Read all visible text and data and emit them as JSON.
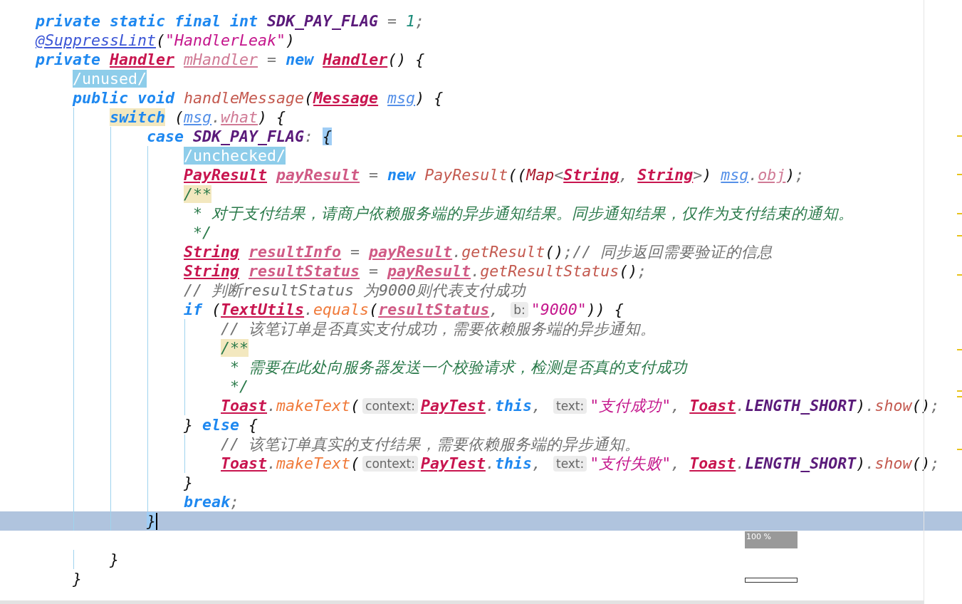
{
  "editor": {
    "zoom_label": "100 %",
    "lines": [
      {
        "current": false,
        "tokens": [
          {
            "kind": "keyword",
            "text": "private static final int"
          },
          {
            "kind": "constant",
            "text": " SDK_PAY_FLAG"
          },
          {
            "kind": "operator",
            "text": " = "
          },
          {
            "kind": "number",
            "text": "1"
          },
          {
            "kind": "operator",
            "text": ";"
          }
        ]
      },
      {
        "current": false,
        "tokens": [
          {
            "kind": "annotation",
            "text": "@SuppressLint"
          },
          {
            "kind": "punct",
            "text": "("
          },
          {
            "kind": "string",
            "text": "\"HandlerLeak\""
          },
          {
            "kind": "punct",
            "text": ")"
          }
        ]
      },
      {
        "current": false,
        "tokens": [
          {
            "kind": "keyword",
            "text": "private"
          },
          {
            "kind": "type",
            "text": " Handler"
          },
          {
            "kind": "field",
            "text": " mHandler"
          },
          {
            "kind": "operator",
            "text": " = "
          },
          {
            "kind": "keyword",
            "text": "new"
          },
          {
            "kind": "type",
            "text": " Handler"
          },
          {
            "kind": "punct",
            "text": "() {"
          }
        ]
      },
      {
        "current": false,
        "tokens": [
          {
            "kind": "tag",
            "text": "    /unused/"
          }
        ]
      },
      {
        "current": false,
        "tokens": [
          {
            "kind": "keyword",
            "text": "    public void"
          },
          {
            "kind": "method",
            "text": " handleMessage"
          },
          {
            "kind": "punct",
            "text": "("
          },
          {
            "kind": "type",
            "text": "Message"
          },
          {
            "kind": "param",
            "text": " msg"
          },
          {
            "kind": "punct",
            "text": ") {"
          }
        ]
      },
      {
        "current": false,
        "tokens": [
          {
            "kind": "marked",
            "text": "        switch"
          },
          {
            "kind": "punct",
            "text": " ("
          },
          {
            "kind": "param",
            "text": "msg"
          },
          {
            "kind": "operator",
            "text": "."
          },
          {
            "kind": "field",
            "text": "what"
          },
          {
            "kind": "punct",
            "text": ") {"
          }
        ]
      },
      {
        "current": false,
        "tokens": [
          {
            "kind": "keyword",
            "text": "            case"
          },
          {
            "kind": "constant",
            "text": " SDK_PAY_FLAG"
          },
          {
            "kind": "operator",
            "text": ": "
          },
          {
            "kind": "brace",
            "text": "{"
          }
        ]
      },
      {
        "current": false,
        "tokens": [
          {
            "kind": "tag",
            "text": "                /unchecked/"
          }
        ]
      },
      {
        "current": false,
        "tokens": [
          {
            "kind": "type",
            "text": "                PayResult"
          },
          {
            "kind": "local",
            "text": " payResult"
          },
          {
            "kind": "operator",
            "text": " = "
          },
          {
            "kind": "keyword",
            "text": "new"
          },
          {
            "kind": "method",
            "text": " PayResult"
          },
          {
            "kind": "punct",
            "text": "(("
          },
          {
            "kind": "class",
            "text": "Map"
          },
          {
            "kind": "operator",
            "text": "<"
          },
          {
            "kind": "type",
            "text": "String"
          },
          {
            "kind": "operator",
            "text": ", "
          },
          {
            "kind": "type",
            "text": "String"
          },
          {
            "kind": "operator",
            "text": ">"
          },
          {
            "kind": "punct",
            "text": ") "
          },
          {
            "kind": "param",
            "text": "msg"
          },
          {
            "kind": "operator",
            "text": "."
          },
          {
            "kind": "field",
            "text": "obj"
          },
          {
            "kind": "punct",
            "text": ")"
          },
          {
            "kind": "operator",
            "text": ";"
          }
        ]
      },
      {
        "current": false,
        "tokens": [
          {
            "kind": "docmark",
            "text": "                /**"
          }
        ]
      },
      {
        "current": false,
        "tokens": [
          {
            "kind": "doc",
            "text": "                 * 对于支付结果，请商户依赖服务端的异步通知结果。同步通知结果，仅作为支付结束的通知。"
          }
        ]
      },
      {
        "current": false,
        "tokens": [
          {
            "kind": "doc",
            "text": "                 */"
          }
        ]
      },
      {
        "current": false,
        "tokens": [
          {
            "kind": "type",
            "text": "                String"
          },
          {
            "kind": "local",
            "text": " resultInfo"
          },
          {
            "kind": "operator",
            "text": " = "
          },
          {
            "kind": "local",
            "text": "payResult"
          },
          {
            "kind": "operator",
            "text": "."
          },
          {
            "kind": "method",
            "text": "getResult"
          },
          {
            "kind": "punct",
            "text": "()"
          },
          {
            "kind": "operator",
            "text": ";"
          },
          {
            "kind": "comment",
            "text": "// 同步返回需要验证的信息"
          }
        ]
      },
      {
        "current": false,
        "tokens": [
          {
            "kind": "type",
            "text": "                String"
          },
          {
            "kind": "local",
            "text": " resultStatus"
          },
          {
            "kind": "operator",
            "text": " = "
          },
          {
            "kind": "local",
            "text": "payResult"
          },
          {
            "kind": "operator",
            "text": "."
          },
          {
            "kind": "method",
            "text": "getResultStatus"
          },
          {
            "kind": "punct",
            "text": "()"
          },
          {
            "kind": "operator",
            "text": ";"
          }
        ]
      },
      {
        "current": false,
        "tokens": [
          {
            "kind": "comment",
            "text": "                // 判断resultStatus 为9000则代表支付成功"
          }
        ]
      },
      {
        "current": false,
        "tokens": [
          {
            "kind": "keyword",
            "text": "                if"
          },
          {
            "kind": "punct",
            "text": " ("
          },
          {
            "kind": "type",
            "text": "TextUtils"
          },
          {
            "kind": "operator",
            "text": "."
          },
          {
            "kind": "call",
            "text": "equals"
          },
          {
            "kind": "punct",
            "text": "("
          },
          {
            "kind": "local",
            "text": "resultStatus"
          },
          {
            "kind": "operator",
            "text": ", "
          },
          {
            "kind": "hint",
            "text": "b:"
          },
          {
            "kind": "string",
            "text": "\"9000\""
          },
          {
            "kind": "punct",
            "text": ")) {"
          }
        ]
      },
      {
        "current": false,
        "tokens": [
          {
            "kind": "comment",
            "text": "                    // 该笔订单是否真实支付成功，需要依赖服务端的异步通知。"
          }
        ]
      },
      {
        "current": false,
        "tokens": [
          {
            "kind": "docmark",
            "text": "                    /**"
          }
        ]
      },
      {
        "current": false,
        "tokens": [
          {
            "kind": "doc",
            "text": "                     * 需要在此处向服务器发送一个校验请求，检测是否真的支付成功"
          }
        ]
      },
      {
        "current": false,
        "tokens": [
          {
            "kind": "doc",
            "text": "                     */"
          }
        ]
      },
      {
        "current": false,
        "tokens": [
          {
            "kind": "type",
            "text": "                    Toast"
          },
          {
            "kind": "operator",
            "text": "."
          },
          {
            "kind": "call",
            "text": "makeText"
          },
          {
            "kind": "punct",
            "text": "("
          },
          {
            "kind": "hint",
            "text": "context:"
          },
          {
            "kind": "type",
            "text": "PayTest"
          },
          {
            "kind": "operator",
            "text": "."
          },
          {
            "kind": "keyword",
            "text": "this"
          },
          {
            "kind": "operator",
            "text": ", "
          },
          {
            "kind": "hint",
            "text": "text:"
          },
          {
            "kind": "string",
            "text": "\"支付成功\""
          },
          {
            "kind": "operator",
            "text": ", "
          },
          {
            "kind": "type",
            "text": "Toast"
          },
          {
            "kind": "operator",
            "text": "."
          },
          {
            "kind": "constant",
            "text": "LENGTH_SHORT"
          },
          {
            "kind": "punct",
            "text": ")"
          },
          {
            "kind": "operator",
            "text": "."
          },
          {
            "kind": "method",
            "text": "show"
          },
          {
            "kind": "punct",
            "text": "()"
          },
          {
            "kind": "operator",
            "text": ";"
          }
        ]
      },
      {
        "current": false,
        "tokens": [
          {
            "kind": "punct",
            "text": "                }"
          },
          {
            "kind": "keyword",
            "text": " else"
          },
          {
            "kind": "punct",
            "text": " {"
          }
        ]
      },
      {
        "current": false,
        "tokens": [
          {
            "kind": "comment",
            "text": "                    // 该笔订单真实的支付结果，需要依赖服务端的异步通知。"
          }
        ]
      },
      {
        "current": false,
        "tokens": [
          {
            "kind": "type",
            "text": "                    Toast"
          },
          {
            "kind": "operator",
            "text": "."
          },
          {
            "kind": "call",
            "text": "makeText"
          },
          {
            "kind": "punct",
            "text": "("
          },
          {
            "kind": "hint",
            "text": "context:"
          },
          {
            "kind": "type",
            "text": "PayTest"
          },
          {
            "kind": "operator",
            "text": "."
          },
          {
            "kind": "keyword",
            "text": "this"
          },
          {
            "kind": "operator",
            "text": ", "
          },
          {
            "kind": "hint",
            "text": "text:"
          },
          {
            "kind": "string",
            "text": "\"支付失败\""
          },
          {
            "kind": "operator",
            "text": ", "
          },
          {
            "kind": "type",
            "text": "Toast"
          },
          {
            "kind": "operator",
            "text": "."
          },
          {
            "kind": "constant",
            "text": "LENGTH_SHORT"
          },
          {
            "kind": "punct",
            "text": ")"
          },
          {
            "kind": "operator",
            "text": "."
          },
          {
            "kind": "method",
            "text": "show"
          },
          {
            "kind": "punct",
            "text": "()"
          },
          {
            "kind": "operator",
            "text": ";"
          }
        ]
      },
      {
        "current": false,
        "tokens": [
          {
            "kind": "punct",
            "text": "                }"
          }
        ]
      },
      {
        "current": false,
        "tokens": [
          {
            "kind": "keyword",
            "text": "                break"
          },
          {
            "kind": "operator",
            "text": ";"
          }
        ]
      },
      {
        "current": true,
        "tokens": [
          {
            "kind": "brace",
            "text": "            }"
          }
        ]
      },
      {
        "current": false
      },
      {
        "current": false,
        "tokens": [
          {
            "kind": "punct",
            "text": "        }"
          }
        ]
      },
      {
        "current": false,
        "tokens": [
          {
            "kind": "punct",
            "text": "    }"
          }
        ]
      }
    ]
  }
}
